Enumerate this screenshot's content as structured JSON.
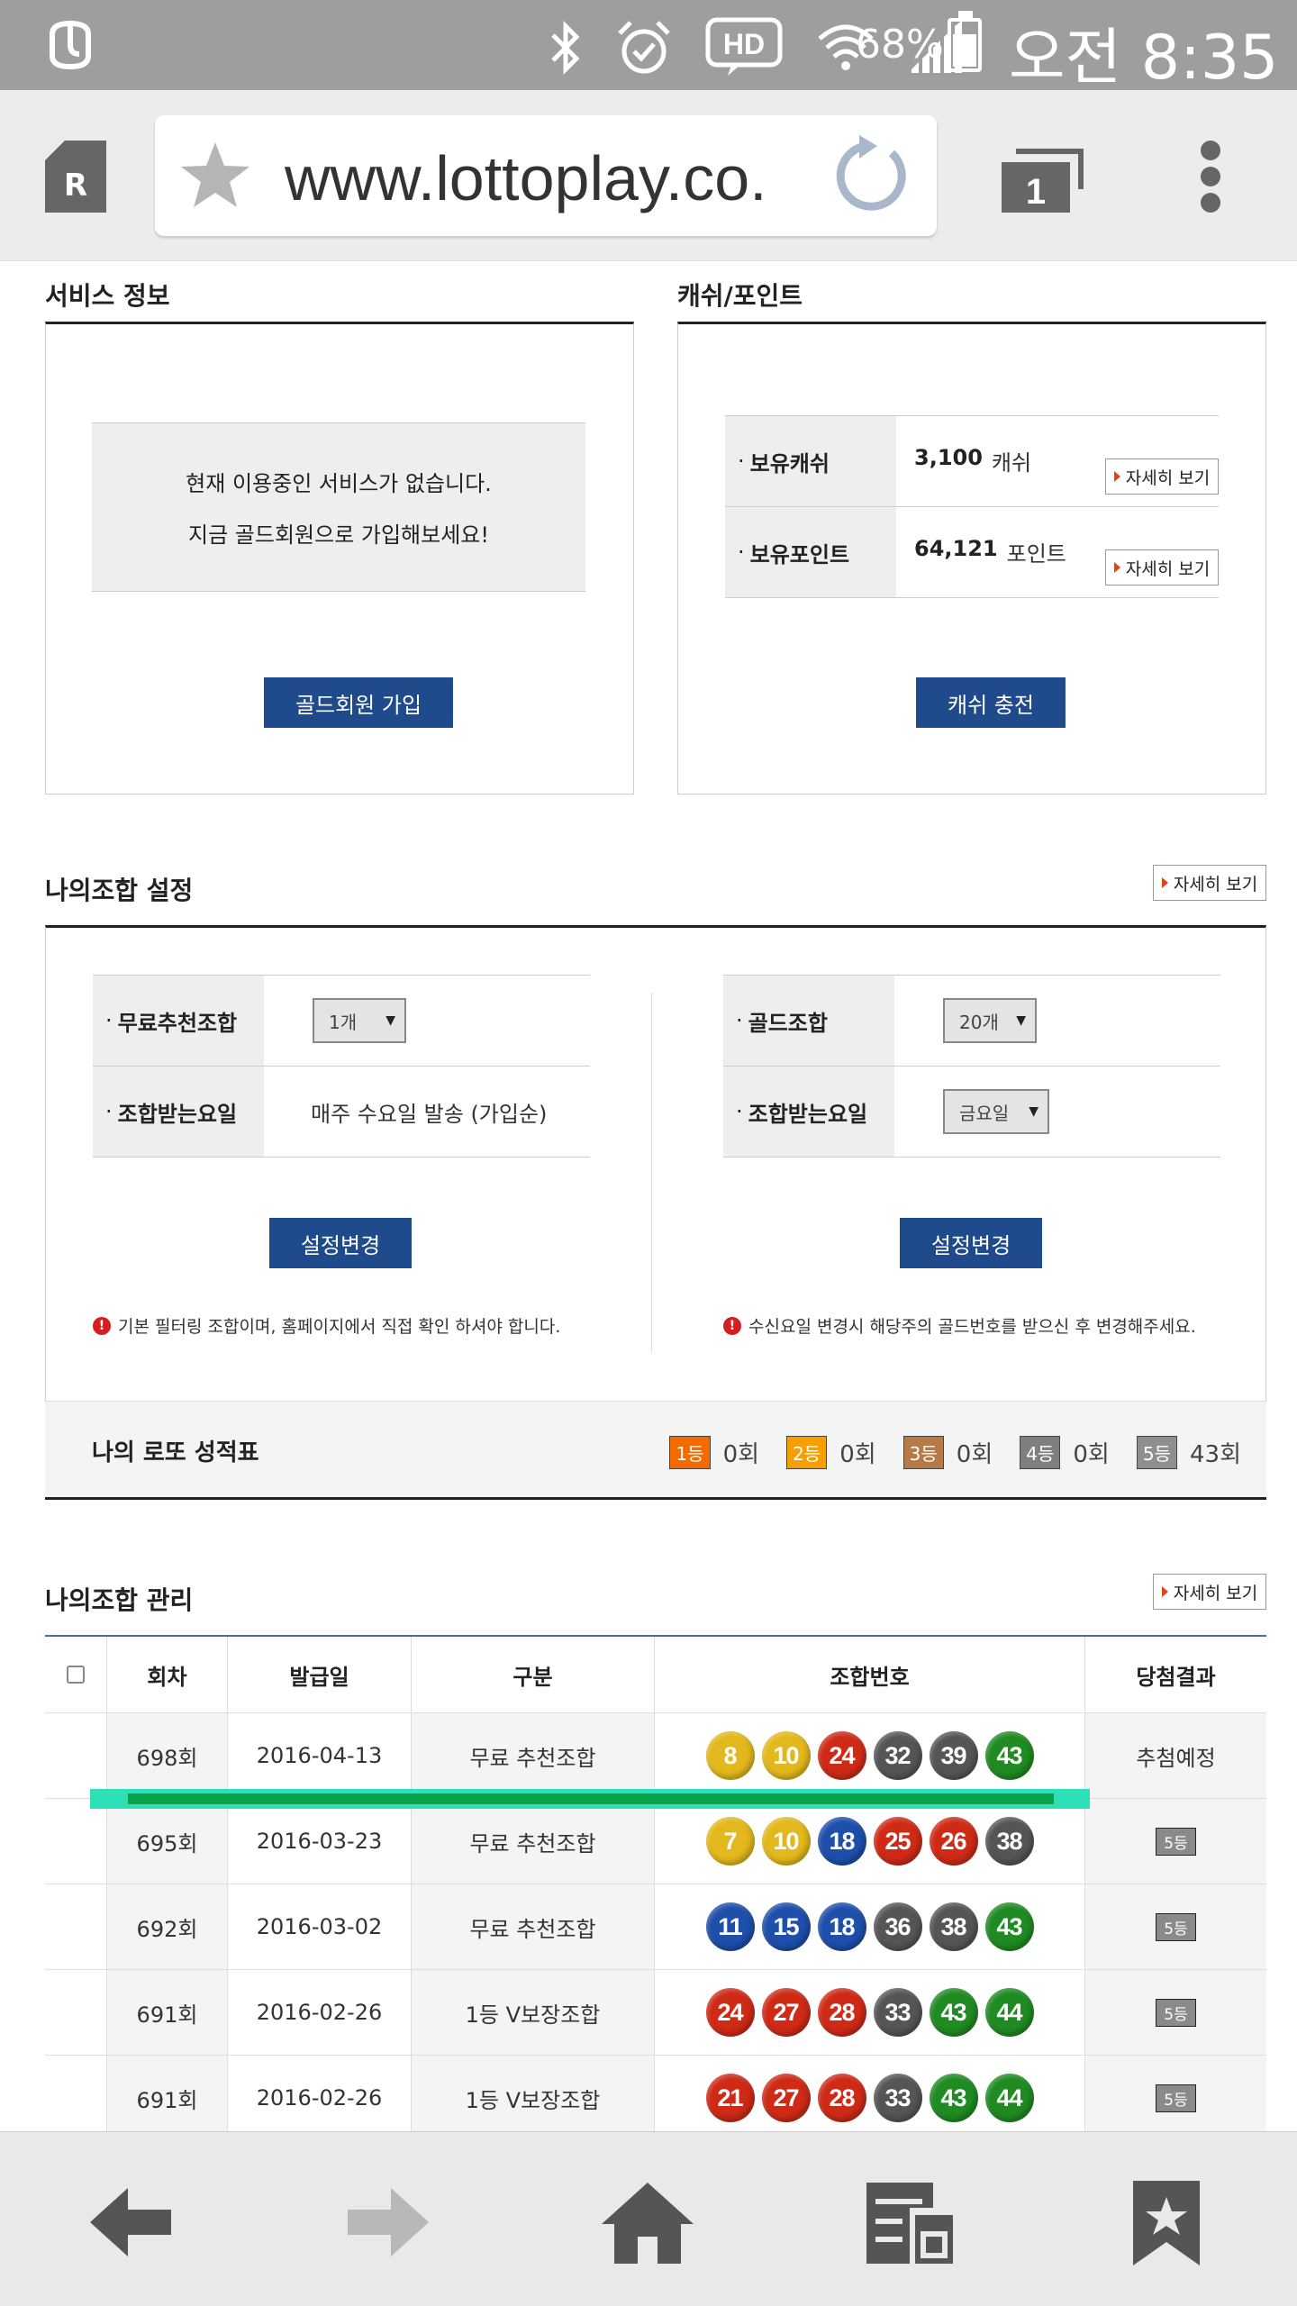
{
  "status_bar": {
    "battery": "68%",
    "time": "오전 8:35",
    "icons": [
      "app-logo-icon",
      "bluetooth-icon",
      "alarm-icon",
      "hd-voice-icon",
      "wifi-icon",
      "signal-icon",
      "battery-icon"
    ]
  },
  "browser": {
    "tab_letter": "R",
    "url": "www.lottoplay.co.",
    "tab_count": "1"
  },
  "service_info": {
    "title": "서비스 정보",
    "message_line1": "현재 이용중인 서비스가 없습니다.",
    "message_line2": "지금 골드회원으로 가입해보세요!",
    "join_button": "골드회원 가입"
  },
  "cash_point": {
    "title": "캐쉬/포인트",
    "rows": [
      {
        "label": "보유캐쉬",
        "value": "3,100",
        "unit": "캐쉬",
        "detail": "자세히 보기"
      },
      {
        "label": "보유포인트",
        "value": "64,121",
        "unit": "포인트",
        "detail": "자세히 보기"
      }
    ],
    "charge_button": "캐쉬 충전"
  },
  "combo_settings": {
    "title": "나의조합 설정",
    "detail": "자세히 보기",
    "left": {
      "row1_label": "무료추천조합",
      "row1_select": "1개",
      "row2_label": "조합받는요일",
      "row2_value": "매주 수요일 발송 (가입순)",
      "button": "설정변경",
      "notice": "기본 필터링 조합이며, 홈페이지에서 직접 확인 하셔야 합니다."
    },
    "right": {
      "row1_label": "골드조합",
      "row1_select": "20개",
      "row2_label": "조합받는요일",
      "row2_select": "금요일",
      "button": "설정변경",
      "notice": "수신요일 변경시 해당주의 골드번호를 받으신 후 변경해주세요."
    }
  },
  "score": {
    "title": "나의 로또 성적표",
    "items": [
      {
        "rank": "1등",
        "count": "0회",
        "color": "#f26a00"
      },
      {
        "rank": "2등",
        "count": "0회",
        "color": "#f5a000"
      },
      {
        "rank": "3등",
        "count": "0회",
        "color": "#b57a45"
      },
      {
        "rank": "4등",
        "count": "0회",
        "color": "#7f7f7f"
      },
      {
        "rank": "5등",
        "count": "43회",
        "color": "#8f8f8f"
      }
    ]
  },
  "combo_manage": {
    "title": "나의조합 관리",
    "detail": "자세히 보기",
    "headers": [
      "회차",
      "발급일",
      "구분",
      "조합번호",
      "당첨결과"
    ],
    "rows": [
      {
        "round": "698회",
        "date": "2016-04-13",
        "type": "무료 추천조합",
        "numbers": [
          "8",
          "10",
          "24",
          "32",
          "39",
          "43"
        ],
        "colors": [
          "yellow",
          "yellow",
          "red",
          "gray",
          "gray",
          "green"
        ],
        "result": "추첨예정",
        "result_badge": false
      },
      {
        "round": "695회",
        "date": "2016-03-23",
        "type": "무료 추천조합",
        "numbers": [
          "7",
          "10",
          "18",
          "25",
          "26",
          "38"
        ],
        "colors": [
          "yellow",
          "yellow",
          "blue",
          "red",
          "red",
          "gray"
        ],
        "result": "5등",
        "result_badge": true
      },
      {
        "round": "692회",
        "date": "2016-03-02",
        "type": "무료 추천조합",
        "numbers": [
          "11",
          "15",
          "18",
          "36",
          "38",
          "43"
        ],
        "colors": [
          "blue",
          "blue",
          "blue",
          "gray",
          "gray",
          "green"
        ],
        "result": "5등",
        "result_badge": true
      },
      {
        "round": "691회",
        "date": "2016-02-26",
        "type": "1등 V보장조합",
        "numbers": [
          "24",
          "27",
          "28",
          "33",
          "43",
          "44"
        ],
        "colors": [
          "red",
          "red",
          "red",
          "gray",
          "green",
          "green"
        ],
        "result": "5등",
        "result_badge": true
      },
      {
        "round": "691회",
        "date": "2016-02-26",
        "type": "1등 V보장조합",
        "numbers": [
          "21",
          "27",
          "28",
          "33",
          "43",
          "44"
        ],
        "colors": [
          "red",
          "red",
          "red",
          "gray",
          "green",
          "green"
        ],
        "result": "5등",
        "result_badge": true
      }
    ]
  },
  "bottom_nav": [
    "back-icon",
    "forward-icon",
    "home-icon",
    "reader-icon",
    "bookmarks-icon"
  ]
}
